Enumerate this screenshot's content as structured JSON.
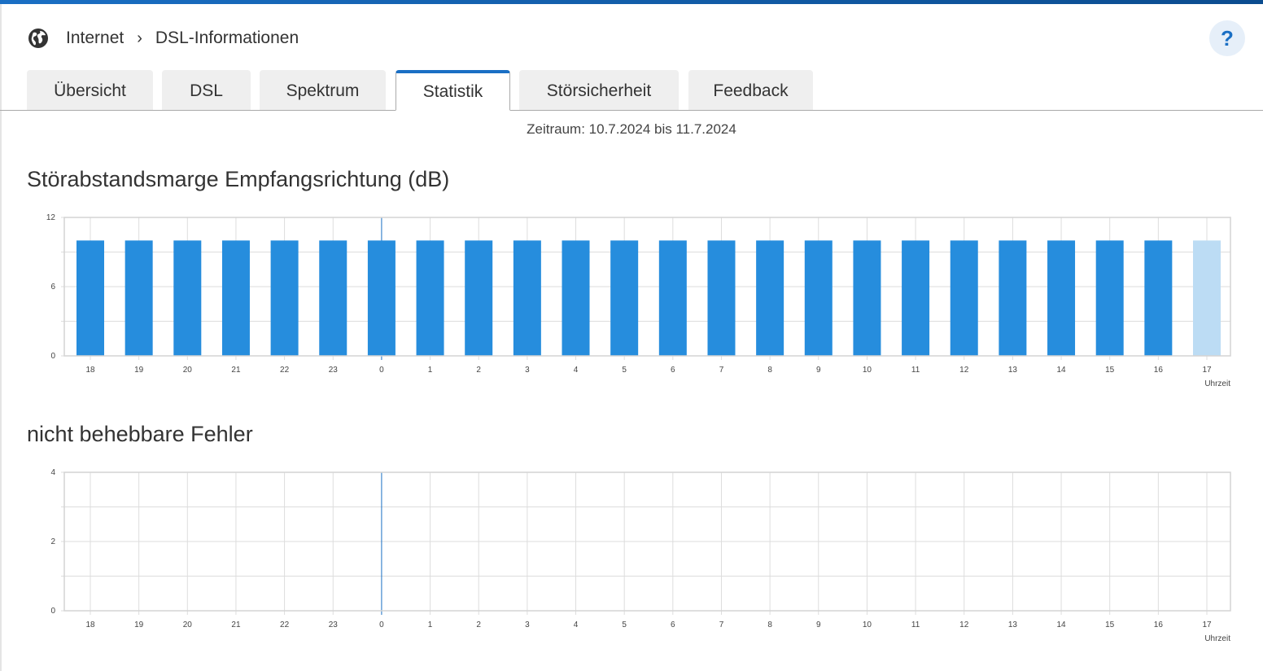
{
  "breadcrumb": {
    "icon": "globe-icon",
    "items": [
      "Internet",
      "DSL-Informationen"
    ]
  },
  "help": {
    "label": "?"
  },
  "tabs": [
    {
      "label": "Übersicht"
    },
    {
      "label": "DSL"
    },
    {
      "label": "Spektrum"
    },
    {
      "label": "Statistik",
      "active": true
    },
    {
      "label": "Störsicherheit"
    },
    {
      "label": "Feedback"
    }
  ],
  "range": "Zeitraum: 10.7.2024 bis 11.7.2024",
  "colors": {
    "bar": "#268ddd",
    "bar_current": "#bcdcf4",
    "accent": "#1a6fc4",
    "marker": "#1a6fc4"
  },
  "chart_data": [
    {
      "type": "bar",
      "title": "Störabstandsmarge Empfangsrichtung (dB)",
      "xlabel": "Uhrzeit",
      "ylabel": "",
      "categories": [
        "18",
        "19",
        "20",
        "21",
        "22",
        "23",
        "0",
        "1",
        "2",
        "3",
        "4",
        "5",
        "6",
        "7",
        "8",
        "9",
        "10",
        "11",
        "12",
        "13",
        "14",
        "15",
        "16",
        "17"
      ],
      "values": [
        10,
        10,
        10,
        10,
        10,
        10,
        10,
        10,
        10,
        10,
        10,
        10,
        10,
        10,
        10,
        10,
        10,
        10,
        10,
        10,
        10,
        10,
        10,
        10
      ],
      "current_index": 23,
      "marker_category": "0",
      "ylim": [
        0,
        12
      ],
      "yticks": [
        "0",
        "6",
        "12"
      ],
      "ygrid_step": 3,
      "grid": true
    },
    {
      "type": "bar",
      "title": "nicht behebbare Fehler",
      "xlabel": "Uhrzeit",
      "ylabel": "",
      "categories": [
        "18",
        "19",
        "20",
        "21",
        "22",
        "23",
        "0",
        "1",
        "2",
        "3",
        "4",
        "5",
        "6",
        "7",
        "8",
        "9",
        "10",
        "11",
        "12",
        "13",
        "14",
        "15",
        "16",
        "17"
      ],
      "values": [
        0,
        0,
        0,
        0,
        0,
        0,
        0,
        0,
        0,
        0,
        0,
        0,
        0,
        0,
        0,
        0,
        0,
        0,
        0,
        0,
        0,
        0,
        0,
        0
      ],
      "current_index": 23,
      "marker_category": "0",
      "ylim": [
        0,
        4
      ],
      "yticks": [
        "0",
        "2",
        "4"
      ],
      "ygrid_step": 1,
      "grid": true
    }
  ]
}
